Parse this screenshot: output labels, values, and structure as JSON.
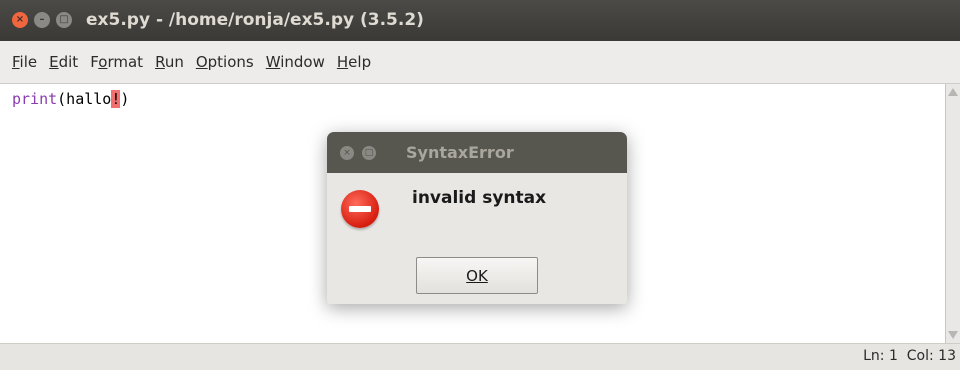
{
  "window": {
    "title": "ex5.py - /home/ronja/ex5.py (3.5.2)",
    "close_glyph": "×",
    "minimize_glyph": "–",
    "maximize_glyph": "□"
  },
  "menu": {
    "items": [
      {
        "label": "File",
        "mnemonic": "F"
      },
      {
        "label": "Edit",
        "mnemonic": "E"
      },
      {
        "label": "Format",
        "mnemonic": "o"
      },
      {
        "label": "Run",
        "mnemonic": "R"
      },
      {
        "label": "Options",
        "mnemonic": "O"
      },
      {
        "label": "Window",
        "mnemonic": "W"
      },
      {
        "label": "Help",
        "mnemonic": "H"
      }
    ]
  },
  "editor": {
    "code_keyword": "print",
    "code_before_error": "(hallo",
    "code_error_char": "!",
    "code_after_error": ")"
  },
  "statusbar": {
    "line_text": "Ln: 1",
    "col_text": "Col: 13"
  },
  "dialog": {
    "title": "SyntaxError",
    "message": "invalid syntax",
    "ok_label": "OK",
    "icon": "stop-error-icon"
  },
  "colors": {
    "titlebar": "#3f3e3a",
    "keyword": "#8a3cb0",
    "error_highlight": "#f07070",
    "error_icon": "#d61d10"
  }
}
